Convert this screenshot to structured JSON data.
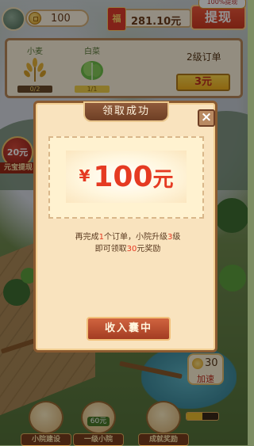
{
  "top_bar": {
    "coins": "100",
    "money": "281.10元",
    "money_icon_glyph": "福",
    "withdraw_label": "提现",
    "withdraw_tag": "100%提现"
  },
  "order": {
    "level_label": "2级订单",
    "reward_label": "3元",
    "items": [
      {
        "name": "小麦",
        "progress": "0/2",
        "progress_value": 0.0
      },
      {
        "name": "白菜",
        "progress": "1/1",
        "progress_value": 1.0
      }
    ]
  },
  "side_badge": {
    "amount": "20元",
    "label": "元宝提现"
  },
  "speed_badge": {
    "value": "30",
    "label": "加速"
  },
  "bottom_bar": {
    "buttons": [
      {
        "label": "小院建设",
        "icon": "gate-icon"
      },
      {
        "label": "一级小院",
        "tag": "60元",
        "icon": "coin-stack-icon"
      },
      {
        "label": "成就奖励",
        "icon": "treasure-icon"
      }
    ],
    "mini_progress": 0.5
  },
  "modal": {
    "title": "领取成功",
    "reward_yen": "¥",
    "reward_number": "100",
    "reward_unit": "元",
    "desc_line1_a": "再完成",
    "desc_line1_b": "1",
    "desc_line1_c": "个订单，小院升级",
    "desc_line1_d": "3",
    "desc_line1_e": "级",
    "desc_line2_a": "即可领取",
    "desc_line2_b": "30",
    "desc_line2_c": "元奖励",
    "collect_label": "收入囊中",
    "close_glyph": "×"
  },
  "colors": {
    "accent_red": "#e53a22",
    "panel_bg": "#f9e3be",
    "frame_brown": "#8a5a30"
  }
}
